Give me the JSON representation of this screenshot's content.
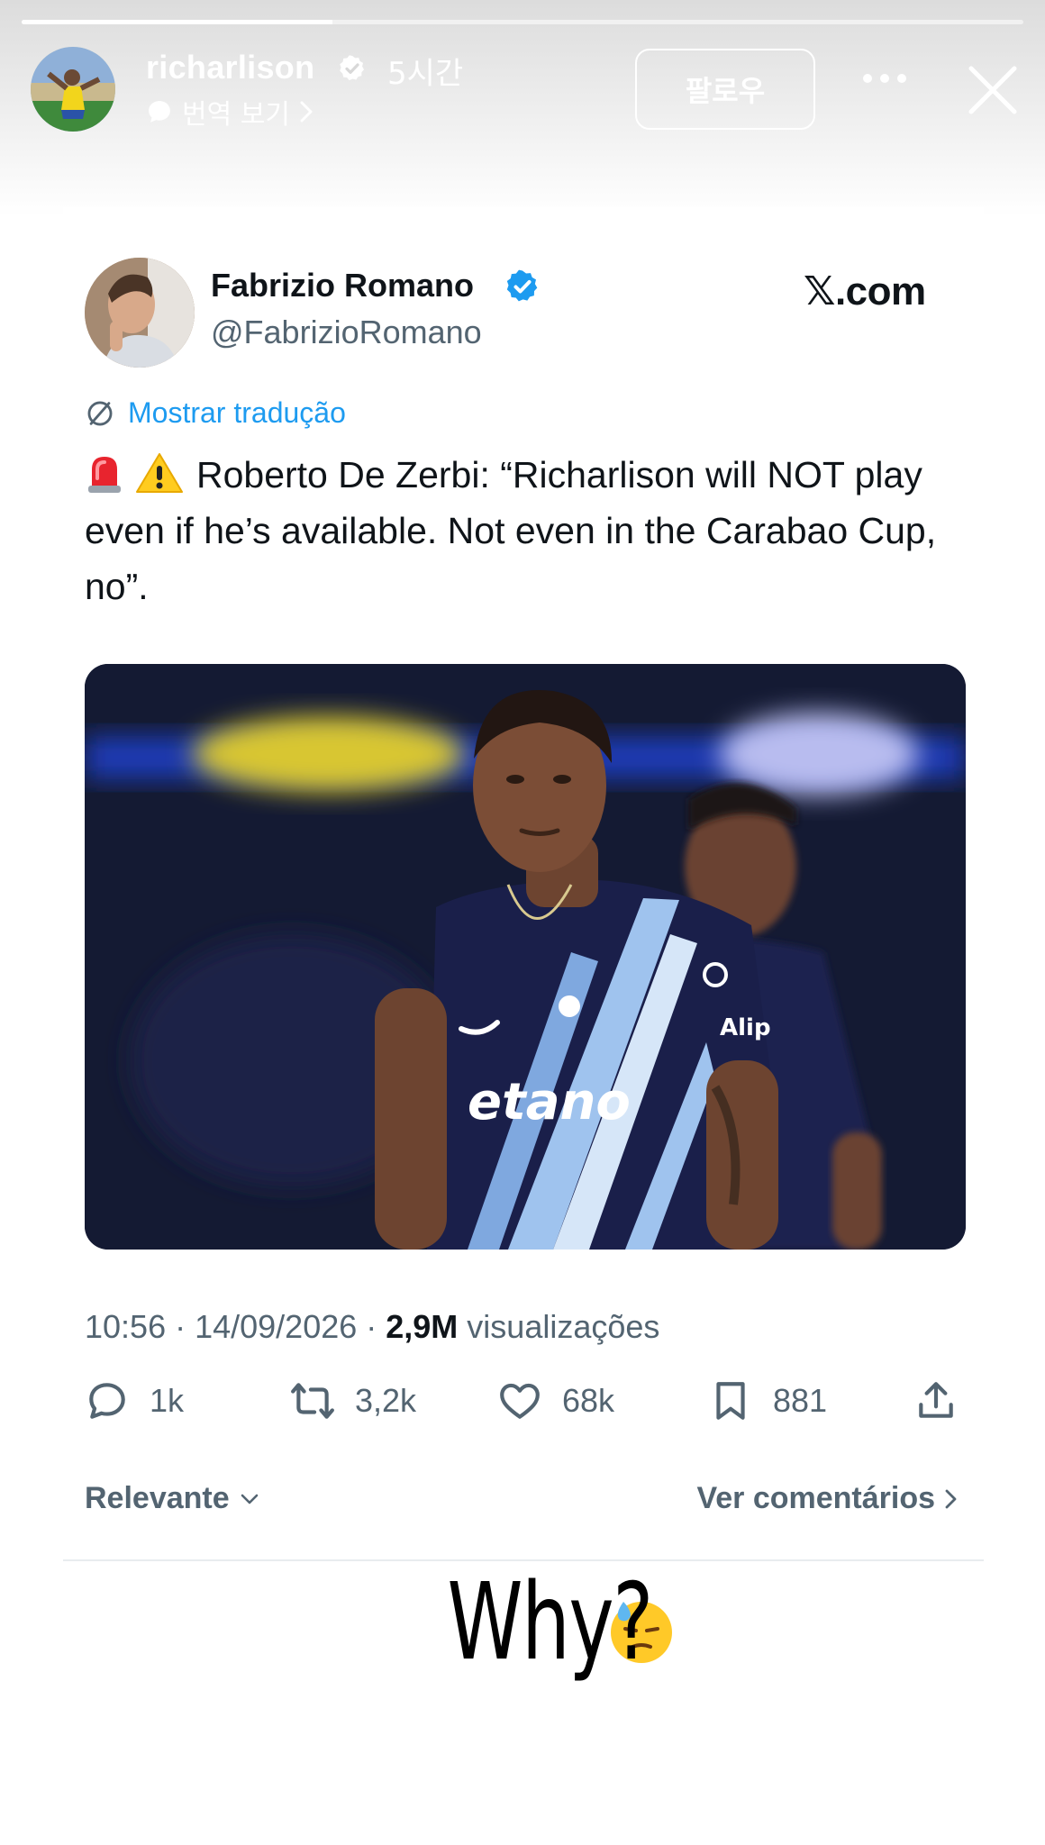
{
  "story": {
    "progress": 0.31,
    "username": "richarlison",
    "time_ago": "5시간",
    "translate_label": "번역 보기",
    "follow_label": "팔로우",
    "caption": "Why?"
  },
  "tweet": {
    "author_name": "Fabrizio Romano",
    "author_handle": "@FabrizioRomano",
    "source": "𝕏.com",
    "translate_link": "Mostrar tradução",
    "text": "Roberto De Zerbi: “Richarlison will NOT play even if he’s available. Not even in the Carabao Cup, no”.",
    "timestamp": "10:56 · 14/09/2026 · ",
    "views_count": "2,9M",
    "views_label": " visualizações",
    "replies": "1k",
    "retweets": "3,2k",
    "likes": "68k",
    "bookmarks": "881",
    "sort_label": "Relevante",
    "comments_link": "Ver comentários"
  },
  "colors": {
    "link_blue": "#1d9bf0",
    "verified_blue": "#1d9bf0",
    "text_primary": "#0f1419",
    "text_secondary": "#536471"
  }
}
